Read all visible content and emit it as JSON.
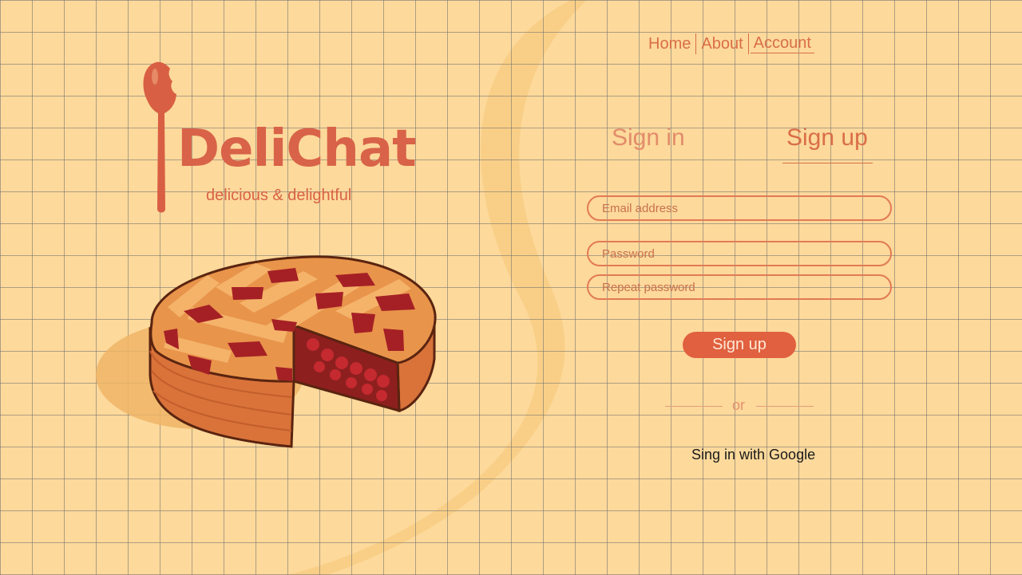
{
  "nav": {
    "home": "Home",
    "about": "About",
    "account": "Account"
  },
  "brand": {
    "name": "DeliChat",
    "tagline": "delicious & delightful"
  },
  "auth": {
    "tab_signin": "Sign in",
    "tab_signup": "Sign up",
    "active_tab": "Sign up",
    "email_placeholder": "Email address",
    "password_placeholder": "Password",
    "repeat_placeholder": "Repeat password",
    "submit_label": "Sign up",
    "divider": "or",
    "google_label": "Sing in with Google"
  },
  "icons": {
    "logo": "spoon-icon",
    "illustration": "cherry-pie-illustration"
  },
  "colors": {
    "background": "#fdd99b",
    "accent": "#d86348",
    "button": "#e0603f",
    "field_border": "#e27a55"
  }
}
